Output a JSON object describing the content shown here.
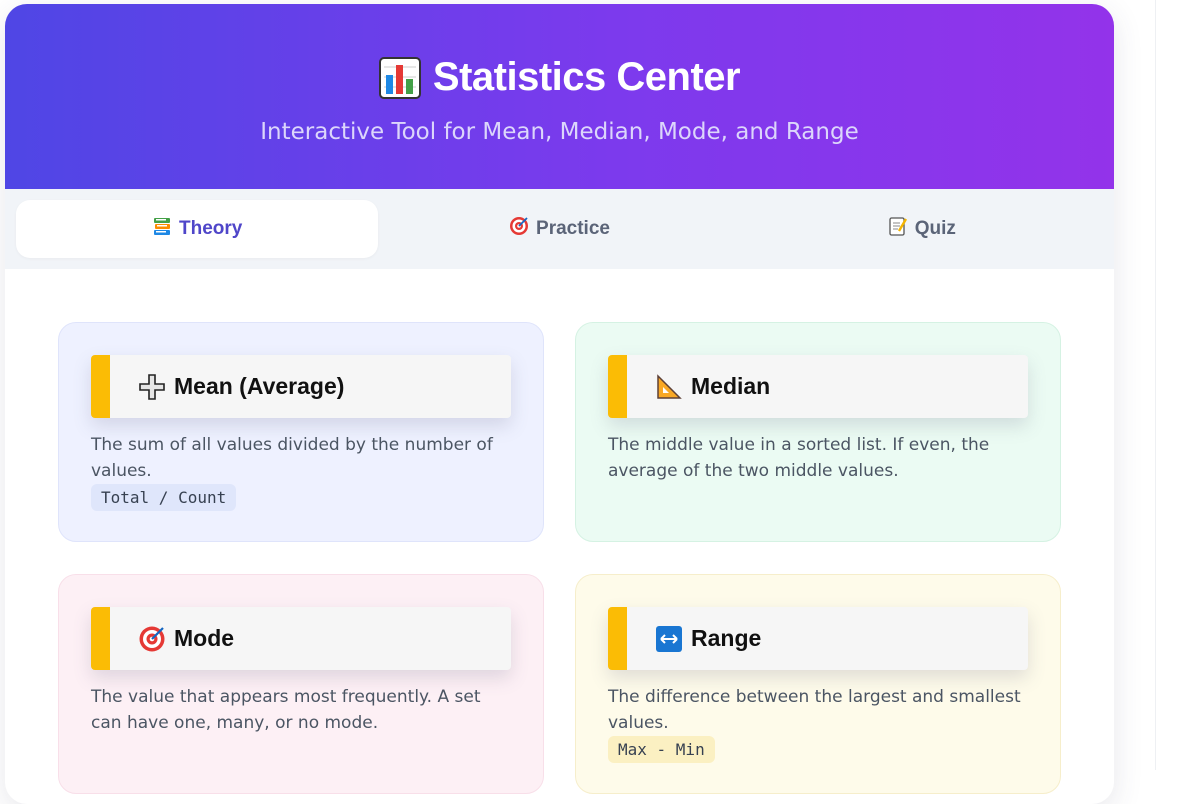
{
  "header": {
    "title": "Statistics Center",
    "subtitle": "Interactive Tool for Mean, Median, Mode, and Range",
    "icon": "bar-chart-icon"
  },
  "tabs": [
    {
      "label": "Theory",
      "icon": "books-icon",
      "active": true
    },
    {
      "label": "Practice",
      "icon": "target-icon",
      "active": false
    },
    {
      "label": "Quiz",
      "icon": "memo-icon",
      "active": false
    }
  ],
  "cards": {
    "mean": {
      "title": "Mean (Average)",
      "icon": "plus-icon",
      "description": "The sum of all values divided by the number of values.",
      "formula": "Total / Count"
    },
    "median": {
      "title": "Median",
      "icon": "triangle-ruler-icon",
      "description": "The middle value in a sorted list. If even, the average of the two middle values."
    },
    "mode": {
      "title": "Mode",
      "icon": "target-icon",
      "description": "The value that appears most frequently. A set can have one, many, or no mode."
    },
    "range": {
      "title": "Range",
      "icon": "left-right-arrow-icon",
      "description": "The difference between the largest and smallest values.",
      "formula": "Max - Min"
    }
  },
  "colors": {
    "header_gradient_start": "#4f46e5",
    "header_gradient_end": "#9333ea",
    "accent_bar": "#fbbc05",
    "active_tab_text": "#4f46c9"
  }
}
